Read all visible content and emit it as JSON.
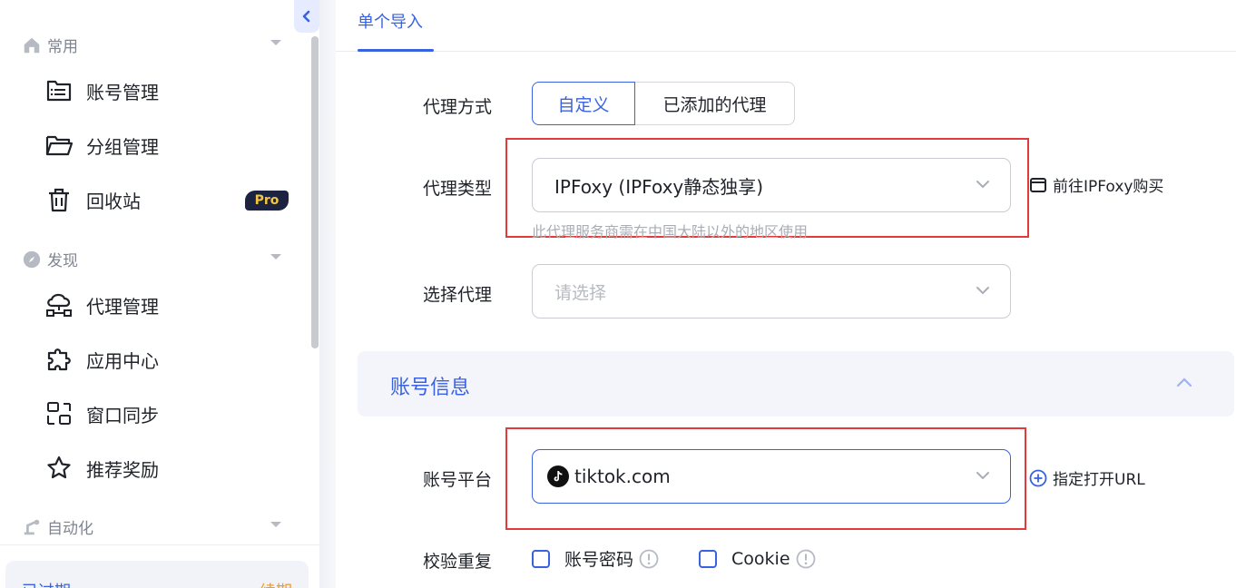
{
  "colors": {
    "accent": "#3a62e0",
    "highlight_box": "#e03a3a",
    "pro_badge_bg": "#1b2340",
    "pro_badge_text": "#f5c542"
  },
  "sidebar": {
    "groups": [
      {
        "label": "常用",
        "icon": "home-icon"
      },
      {
        "label": "发现",
        "icon": "compass-icon"
      },
      {
        "label": "自动化",
        "icon": "robot-arm-icon"
      }
    ],
    "items": [
      {
        "label": "账号管理",
        "icon": "account-list-icon"
      },
      {
        "label": "分组管理",
        "icon": "folder-icon"
      },
      {
        "label": "回收站",
        "icon": "trash-icon",
        "badge": "Pro"
      },
      {
        "label": "代理管理",
        "icon": "cloud-network-icon"
      },
      {
        "label": "应用中心",
        "icon": "puzzle-icon"
      },
      {
        "label": "窗口同步",
        "icon": "window-sync-icon"
      },
      {
        "label": "推荐奖励",
        "icon": "star-icon"
      }
    ],
    "bottom": {
      "left": "已过期",
      "right": "续期"
    }
  },
  "main": {
    "tab": "单个导入",
    "proxy_mode": {
      "label": "代理方式",
      "options": [
        "自定义",
        "已添加的代理"
      ],
      "selected": "自定义"
    },
    "proxy_type": {
      "label": "代理类型",
      "value": "IPFoxy (IPFoxy静态独享)",
      "hint": "此代理服务商需在中国大陆以外的地区使用",
      "link": "前往IPFoxy购买"
    },
    "select_proxy": {
      "label": "选择代理",
      "placeholder": "请选择"
    },
    "section": {
      "title": "账号信息"
    },
    "platform": {
      "label": "账号平台",
      "value": "tiktok.com",
      "link": "指定打开URL"
    },
    "dedupe": {
      "label": "校验重复",
      "options": [
        "账号密码",
        "Cookie"
      ]
    }
  }
}
